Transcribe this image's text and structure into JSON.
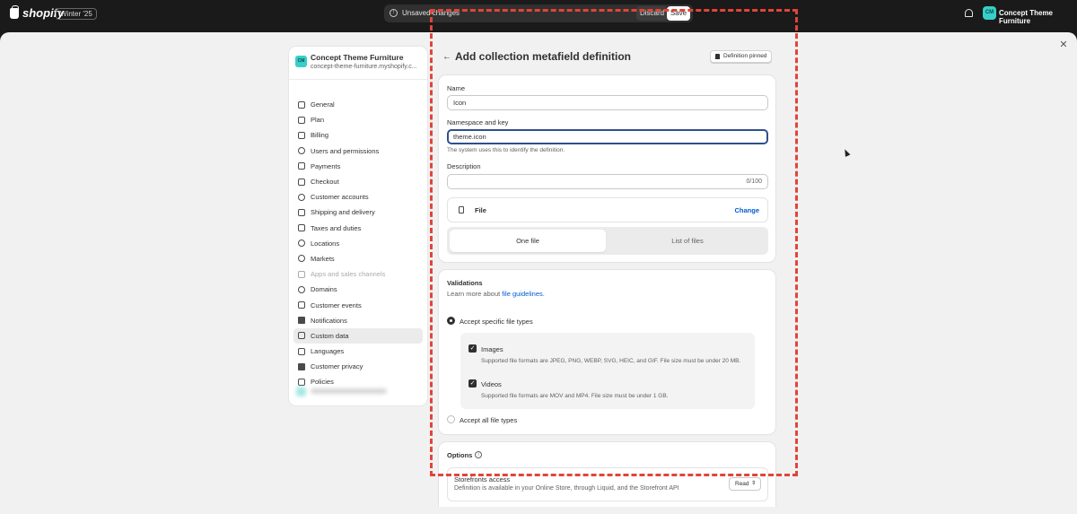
{
  "topbar": {
    "brand": "shopify",
    "version_badge": "Winter '25",
    "unsaved_label": "Unsaved changes",
    "discard_label": "Discard",
    "save_label": "Save",
    "store_initials": "CM",
    "store_name": "Concept Theme Furniture"
  },
  "sidebar": {
    "store_title": "Concept Theme Furniture",
    "store_domain": "concept-theme-furniture.myshopify.c...",
    "items": [
      {
        "label": "General",
        "icon": "store-icon"
      },
      {
        "label": "Plan",
        "icon": "plan-icon"
      },
      {
        "label": "Billing",
        "icon": "billing-icon"
      },
      {
        "label": "Users and permissions",
        "icon": "users-icon"
      },
      {
        "label": "Payments",
        "icon": "payments-icon"
      },
      {
        "label": "Checkout",
        "icon": "cart-icon"
      },
      {
        "label": "Customer accounts",
        "icon": "person-icon"
      },
      {
        "label": "Shipping and delivery",
        "icon": "truck-icon"
      },
      {
        "label": "Taxes and duties",
        "icon": "receipt-icon"
      },
      {
        "label": "Locations",
        "icon": "location-icon"
      },
      {
        "label": "Markets",
        "icon": "globe-icon"
      },
      {
        "label": "Apps and sales channels",
        "icon": "apps-icon"
      },
      {
        "label": "Domains",
        "icon": "domain-icon"
      },
      {
        "label": "Customer events",
        "icon": "events-icon"
      },
      {
        "label": "Notifications",
        "icon": "bell-icon"
      },
      {
        "label": "Custom data",
        "icon": "data-icon"
      },
      {
        "label": "Languages",
        "icon": "language-icon"
      },
      {
        "label": "Customer privacy",
        "icon": "lock-icon"
      },
      {
        "label": "Policies",
        "icon": "policy-icon"
      }
    ],
    "active_item": "Custom data",
    "disabled_item": "Apps and sales channels"
  },
  "page": {
    "title": "Add collection metafield definition",
    "pinned_label": "Definition pinned"
  },
  "definition_form": {
    "name_label": "Name",
    "name_value": "Icon",
    "namespace_label": "Namespace and key",
    "namespace_value": "theme.icon",
    "namespace_hint": "The system uses this to identify the definition.",
    "description_label": "Description",
    "description_value": "",
    "description_counter": "0/100",
    "type_label": "File",
    "change_label": "Change",
    "segment_one": "One file",
    "segment_list": "List of files"
  },
  "validations": {
    "title": "Validations",
    "learn_prefix": "Learn more about ",
    "learn_link": "file guidelines",
    "learn_suffix": ".",
    "accept_specific": "Accept specific file types",
    "images_label": "Images",
    "images_desc": "Supported file formats are JPEG, PNG, WEBP, SVG, HEIC, and GIF. File size must be under 20 MB.",
    "videos_label": "Videos",
    "videos_desc": "Supported file formats are MOV and MP4. File size must be under 1 GB.",
    "accept_all": "Accept all file types"
  },
  "options": {
    "title": "Options",
    "storefront_title": "Storefronts access",
    "storefront_desc": "Definition is available in your Online Store, through Liquid, and the Storefront API",
    "access_value": "Read"
  }
}
